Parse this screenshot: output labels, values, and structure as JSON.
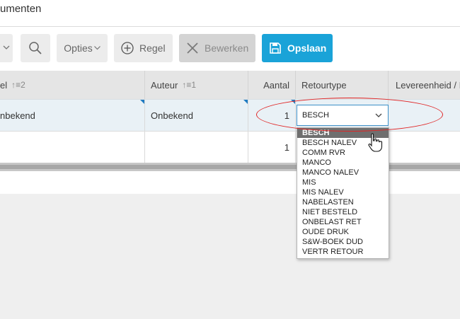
{
  "window": {
    "title": "umenten"
  },
  "toolbar": {
    "opties_label": "Opties",
    "regel_label": "Regel",
    "bewerken_label": "Bewerken",
    "opslaan_label": "Opslaan"
  },
  "grid": {
    "columns": [
      {
        "label": "el",
        "sort": "2"
      },
      {
        "label": "Auteur",
        "sort": "1"
      },
      {
        "label": "Aantal"
      },
      {
        "label": "Retourtype"
      },
      {
        "label": "Levereenheid / I"
      }
    ],
    "rows": [
      {
        "col1": "nbekend",
        "auteur": "Onbekend",
        "aantal": "1"
      },
      {
        "col1": "",
        "auteur": "",
        "aantal": "1"
      }
    ]
  },
  "retourtype_select": {
    "value": "BESCH",
    "options": [
      "BESCH",
      "BESCH NALEV",
      "COMM RVR",
      "MANCO",
      "MANCO NALEV",
      "MIS",
      "MIS NALEV",
      "NABELASTEN",
      "NIET BESTELD",
      "ONBELAST RET",
      "OUDE DRUK",
      "S&W-BOEK DUD",
      "VERTR RETOUR"
    ]
  },
  "colors": {
    "accent": "#1aa3d8",
    "annotation": "#e02424",
    "selected_option": "#6f6f6f"
  }
}
